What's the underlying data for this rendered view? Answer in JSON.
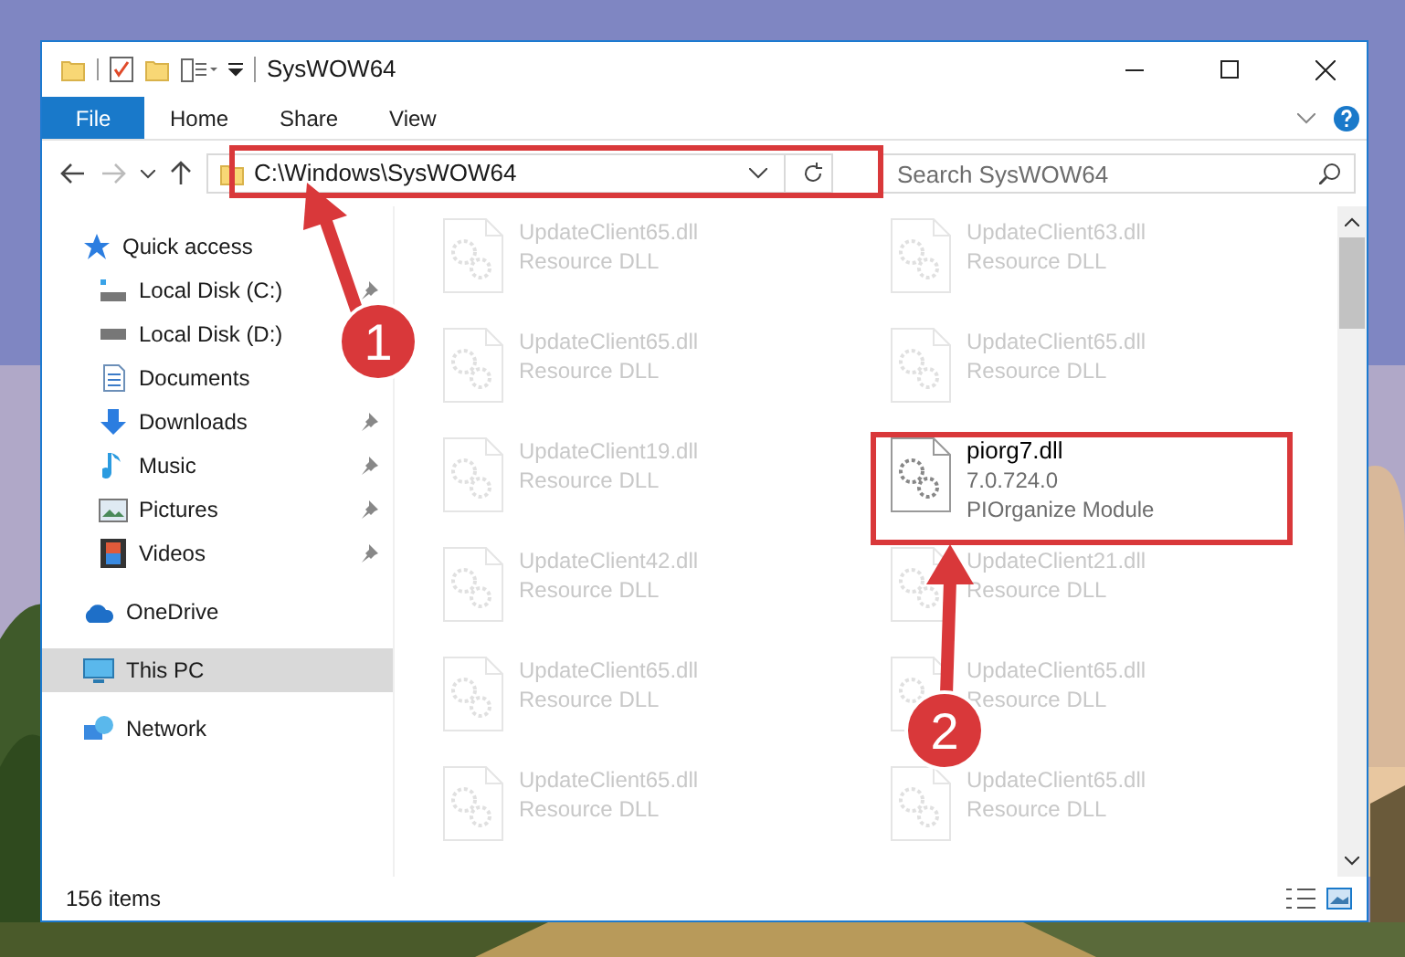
{
  "window": {
    "title": "SysWOW64"
  },
  "ribbon_tabs": [
    {
      "label": "File",
      "selected": true
    },
    {
      "label": "Home",
      "selected": false
    },
    {
      "label": "Share",
      "selected": false
    },
    {
      "label": "View",
      "selected": false
    }
  ],
  "address_bar": {
    "path": "C:\\Windows\\SysWOW64"
  },
  "search": {
    "placeholder": "Search SysWOW64"
  },
  "sidebar": {
    "items": [
      {
        "label": "Quick access",
        "kind": "star",
        "selected": false,
        "children": [
          {
            "label": "Local Disk (C:)",
            "kind": "system-drive",
            "pinned": true
          },
          {
            "label": "Local Disk (D:)",
            "kind": "drive",
            "pinned": false
          },
          {
            "label": "Documents",
            "kind": "documents",
            "pinned": false
          },
          {
            "label": "Downloads",
            "kind": "downloads",
            "pinned": true
          },
          {
            "label": "Music",
            "kind": "music",
            "pinned": true
          },
          {
            "label": "Pictures",
            "kind": "pictures",
            "pinned": true
          },
          {
            "label": "Videos",
            "kind": "videos",
            "pinned": true
          }
        ]
      },
      {
        "label": "OneDrive",
        "kind": "cloud",
        "selected": false
      },
      {
        "label": "This PC",
        "kind": "pc",
        "selected": true
      },
      {
        "label": "Network",
        "kind": "network",
        "selected": false
      }
    ]
  },
  "files": [
    {
      "name": "UpdateClient65.dll",
      "lines": [
        "Resource DLL"
      ],
      "dimmed": true
    },
    {
      "name": "UpdateClient63.dll",
      "lines": [
        "Resource DLL"
      ],
      "dimmed": true
    },
    {
      "name": "UpdateClient65.dll",
      "lines": [
        "Resource DLL"
      ],
      "dimmed": true
    },
    {
      "name": "UpdateClient65.dll",
      "lines": [
        "Resource DLL"
      ],
      "dimmed": true
    },
    {
      "name": "UpdateClient19.dll",
      "lines": [
        "Resource DLL"
      ],
      "dimmed": true
    },
    {
      "name": "piorg7.dll",
      "lines": [
        "7.0.724.0",
        "PIOrganize Module"
      ],
      "dimmed": false
    },
    {
      "name": "UpdateClient42.dll",
      "lines": [
        "Resource DLL"
      ],
      "dimmed": true
    },
    {
      "name": "UpdateClient21.dll",
      "lines": [
        "Resource DLL"
      ],
      "dimmed": true
    },
    {
      "name": "UpdateClient65.dll",
      "lines": [
        "Resource DLL"
      ],
      "dimmed": true
    },
    {
      "name": "UpdateClient65.dll",
      "lines": [
        "Resource DLL"
      ],
      "dimmed": true
    },
    {
      "name": "UpdateClient65.dll",
      "lines": [
        "Resource DLL"
      ],
      "dimmed": true
    },
    {
      "name": "UpdateClient65.dll",
      "lines": [
        "Resource DLL"
      ],
      "dimmed": true
    }
  ],
  "status_bar": {
    "count": "156 items"
  },
  "annotations": [
    {
      "label": "1"
    },
    {
      "label": "2"
    }
  ]
}
